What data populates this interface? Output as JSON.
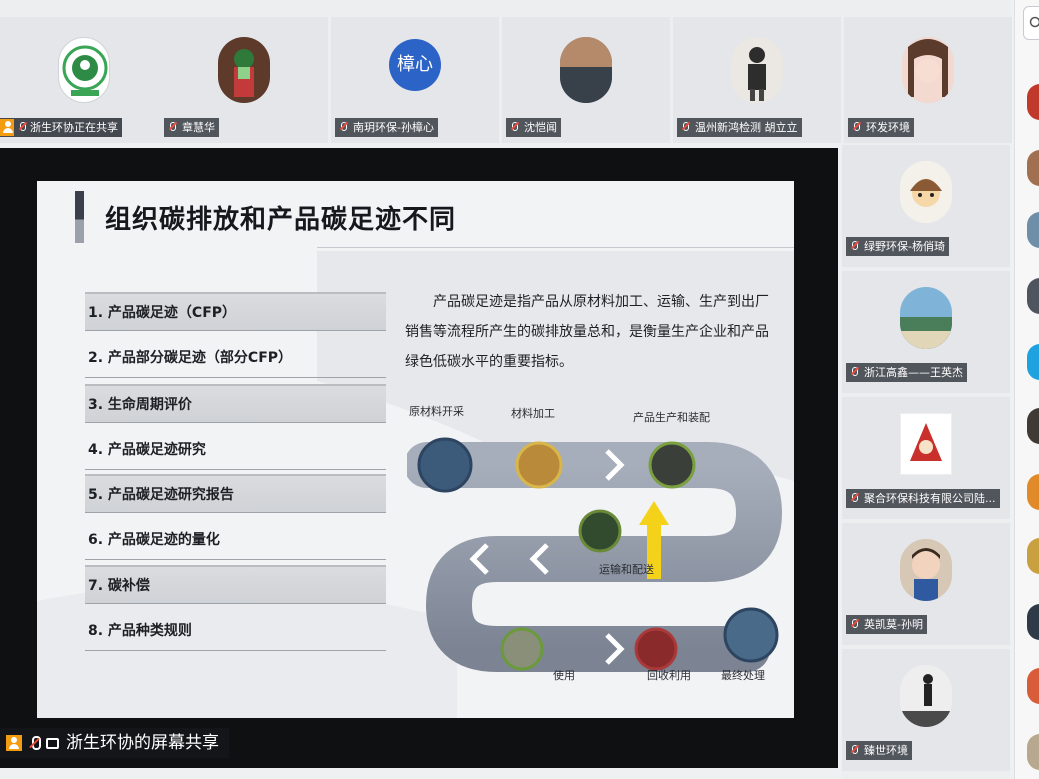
{
  "top_participants": [
    {
      "name": "浙生环协正在共享",
      "avatar": "logo-avatar"
    },
    {
      "name": "章慧华",
      "avatar": "photo-avatar"
    },
    {
      "name": "南玥环保-孙樟心",
      "avatar": "text-avatar",
      "avatar_text": "樟心",
      "avatar_color": "#2b63c6"
    },
    {
      "name": "沈恺闻",
      "avatar": "photo-avatar"
    },
    {
      "name": "温州新鸿检测 胡立立",
      "avatar": "photo-avatar"
    },
    {
      "name": "环发环境",
      "avatar": "photo-avatar"
    }
  ],
  "right_participants": [
    {
      "name": "绿野环保-杨俏琦"
    },
    {
      "name": "浙江高鑫——王英杰"
    },
    {
      "name": "聚合环保科技有限公司陆..."
    },
    {
      "name": "英凯莫-孙明"
    },
    {
      "name": "臻世环境"
    }
  ],
  "screen_share": {
    "label": "浙生环协的屏幕共享"
  },
  "slide": {
    "title": "组织碳排放和产品碳足迹不同",
    "items": [
      "1. 产品碳足迹（CFP）",
      "2. 产品部分碳足迹（部分CFP）",
      "3. 生命周期评价",
      "4. 产品碳足迹研究",
      "5. 产品碳足迹研究报告",
      "6. 产品碳足迹的量化",
      "7. 碳补偿",
      "8. 产品种类规则"
    ],
    "description": "产品碳足迹是指产品从原材料加工、运输、生产到出厂销售等流程所产生的碳排放量总和，是衡量生产企业和产品绿色低碳水平的重要指标。",
    "flow_labels": {
      "raw": "原材料开采",
      "process": "材料加工",
      "produce": "产品生产和装配",
      "transport": "运输和配送",
      "use": "使用",
      "recycle": "回收利用",
      "dispose": "最终处理"
    }
  },
  "colors": {
    "accent_orange": "#f39c12",
    "nametag_bg": "#2c3038",
    "flow_band": "#8f97a6",
    "highlight_arrow": "#f5d21a"
  }
}
